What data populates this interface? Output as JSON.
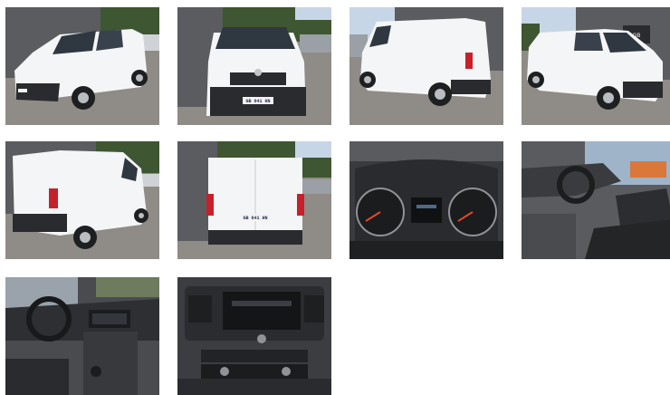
{
  "gallery": {
    "photos": [
      {
        "subject": "van-front-left-exterior",
        "plate": "GB 041 HN"
      },
      {
        "subject": "van-front-exterior",
        "plate": "GB 041 HN"
      },
      {
        "subject": "van-rear-right-exterior"
      },
      {
        "subject": "van-front-right-exterior",
        "sign": "GB"
      },
      {
        "subject": "van-rear-left-exterior"
      },
      {
        "subject": "van-rear-exterior",
        "plate": "GB 041 HN"
      },
      {
        "subject": "instrument-cluster"
      },
      {
        "subject": "cabin-interior-seats"
      },
      {
        "subject": "dashboard-steering-wheel"
      },
      {
        "subject": "center-console-radio"
      }
    ]
  },
  "colors": {
    "van_body": "#f4f5f6",
    "bumper": "#2a2b2e",
    "paving": "#8f8b86",
    "building": "#5b5c5f",
    "sky": "#c7d6e6",
    "trees": "#3e5631",
    "dashboard": "#3a3b3e",
    "taillight": "#c8202a",
    "plate": "#f3f3f3"
  }
}
